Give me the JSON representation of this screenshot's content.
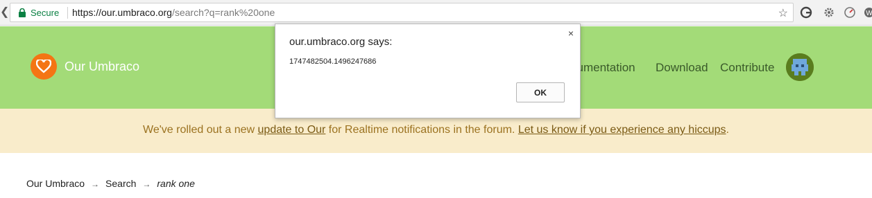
{
  "browser": {
    "secure_label": "Secure",
    "url_base": "https://our.umbraco.org",
    "url_path": "/search?q=rank%20one",
    "icons": [
      "back-arrow-icon",
      "lock-icon",
      "star-icon",
      "extension-g-icon",
      "extension-gear-icon",
      "extension-speed-icon",
      "extension-w-icon"
    ]
  },
  "header": {
    "brand": "Our Umbraco",
    "nav": [
      {
        "label": "cumentation"
      },
      {
        "label": "Download"
      },
      {
        "label": "Contribute"
      }
    ],
    "accent_color": "#a3db78",
    "logo_color": "#f47514"
  },
  "notice": {
    "prefix": "We've rolled out a new ",
    "link1": "update to Our",
    "middle": " for Realtime notifications in the forum. ",
    "link2": "Let us know if you experience any hiccups",
    "suffix": "."
  },
  "breadcrumb": {
    "items": [
      "Our Umbraco",
      "Search",
      "rank one"
    ],
    "separator": "→"
  },
  "dialog": {
    "title": "our.umbraco.org says:",
    "message": "1747482504.1496247686",
    "ok_label": "OK",
    "close_symbol": "×"
  }
}
